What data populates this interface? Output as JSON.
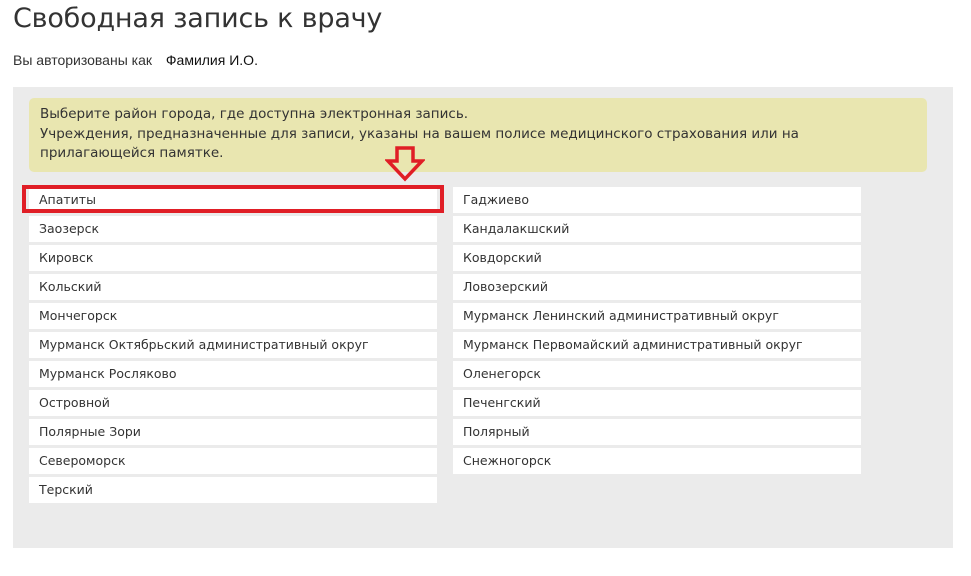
{
  "page": {
    "title": "Свободная запись к врачу",
    "auth_prefix": "Вы авторизованы как",
    "auth_user": "Фамилия И.О."
  },
  "notice": {
    "line1": "Выберите район города, где доступна электронная запись.",
    "line2": "Учреждения, предназначенные для записи, указаны на вашем полисе медицинского страхования или на",
    "line3": "прилагающейся памятке."
  },
  "districts": {
    "left": [
      "Апатиты",
      "Заозерск",
      "Кировск",
      "Кольский",
      "Мончегорск",
      "Мурманск Октябрьский административный округ",
      "Мурманск Росляково",
      "Островной",
      "Полярные Зори",
      "Североморск",
      "Терский"
    ],
    "right": [
      "Гаджиево",
      "Кандалакшский",
      "Ковдорский",
      "Ловозерский",
      "Мурманск Ленинский административный округ",
      "Мурманск Первомайский административный округ",
      "Оленегорск",
      "Печенгский",
      "Полярный",
      "Снежногорск"
    ]
  },
  "annotation": {
    "highlighted_item": "Апатиты",
    "color": "#e01e26",
    "arrow_icon": "arrow-down-icon"
  }
}
